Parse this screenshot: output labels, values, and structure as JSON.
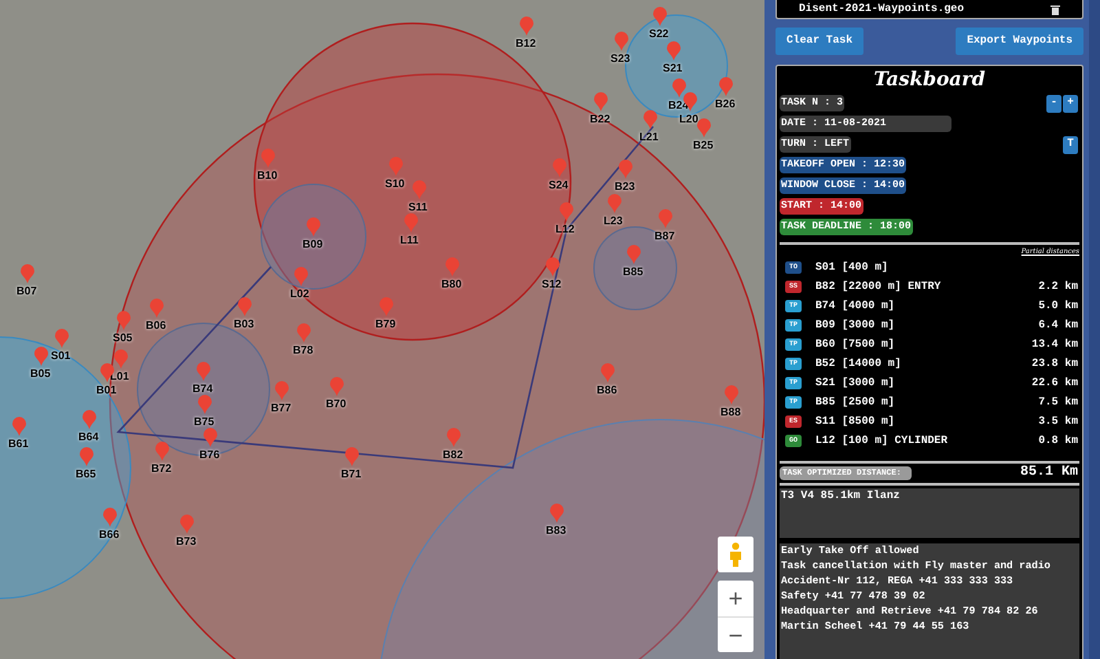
{
  "map": {
    "waypoints": [
      {
        "label": "B12"
      },
      {
        "label": "S22"
      },
      {
        "label": "S23"
      },
      {
        "label": "S21"
      },
      {
        "label": "B24"
      },
      {
        "label": "L20"
      },
      {
        "label": "B26"
      },
      {
        "label": "B22"
      },
      {
        "label": "L21"
      },
      {
        "label": "B25"
      },
      {
        "label": "B10"
      },
      {
        "label": "S10"
      },
      {
        "label": "S11"
      },
      {
        "label": "L11"
      },
      {
        "label": "B09"
      },
      {
        "label": "L02"
      },
      {
        "label": "S24"
      },
      {
        "label": "B23"
      },
      {
        "label": "L23"
      },
      {
        "label": "L12"
      },
      {
        "label": "B87"
      },
      {
        "label": "B80"
      },
      {
        "label": "S12"
      },
      {
        "label": "B85"
      },
      {
        "label": "B79"
      },
      {
        "label": "B07"
      },
      {
        "label": "B06"
      },
      {
        "label": "B03"
      },
      {
        "label": "S05"
      },
      {
        "label": "S01"
      },
      {
        "label": "B05"
      },
      {
        "label": "L01"
      },
      {
        "label": "B01"
      },
      {
        "label": "B78"
      },
      {
        "label": "B74"
      },
      {
        "label": "B75"
      },
      {
        "label": "B77"
      },
      {
        "label": "B70"
      },
      {
        "label": "B61"
      },
      {
        "label": "B64"
      },
      {
        "label": "B65"
      },
      {
        "label": "B72"
      },
      {
        "label": "B76"
      },
      {
        "label": "B71"
      },
      {
        "label": "B66"
      },
      {
        "label": "B73"
      },
      {
        "label": "B86"
      },
      {
        "label": "B88"
      },
      {
        "label": "B82"
      },
      {
        "label": "B83"
      }
    ],
    "zoom_in": "+",
    "zoom_out": "−"
  },
  "file": {
    "name": "Disent-2021-Waypoints.geo"
  },
  "buttons": [
    {
      "label": "Clear Task"
    },
    {
      "label": "Export Waypoints"
    }
  ],
  "taskboard": {
    "title": "Taskboard",
    "fields": [
      {
        "text": "TASK N : 3",
        "kind": "neutral",
        "controls": [
          "-",
          "+"
        ]
      },
      {
        "text": "DATE : 11-08-2021",
        "kind": "neutral",
        "wide": true
      },
      {
        "text": "TURN : LEFT",
        "kind": "neutral",
        "controls": [
          "T"
        ]
      },
      {
        "text": "TAKEOFF OPEN : 12:30",
        "kind": "info"
      },
      {
        "text": "WINDOW CLOSE : 14:00",
        "kind": "info"
      },
      {
        "text": "START : 14:00",
        "kind": "danger"
      },
      {
        "text": "TASK DEADLINE : 18:00",
        "kind": "success"
      }
    ],
    "partial_header": "Partial distances",
    "turnpoints": [
      {
        "type": "TO",
        "kind": "info",
        "name": "S01 [400 m]"
      },
      {
        "type": "SS",
        "kind": "danger",
        "name": "B82 [22000 m] ENTRY",
        "distance": "2.2 km"
      },
      {
        "type": "TP",
        "kind": "turn",
        "name": "B74 [4000 m]",
        "distance": "5.0 km"
      },
      {
        "type": "TP",
        "kind": "turn",
        "name": "B09 [3000 m]",
        "distance": "6.4 km"
      },
      {
        "type": "TP",
        "kind": "turn",
        "name": "B60 [7500 m]",
        "distance": "13.4 km"
      },
      {
        "type": "TP",
        "kind": "turn",
        "name": "B52 [14000 m]",
        "distance": "23.8 km"
      },
      {
        "type": "TP",
        "kind": "turn",
        "name": "S21 [3000 m]",
        "distance": "22.6 km"
      },
      {
        "type": "TP",
        "kind": "turn",
        "name": "B85 [2500 m]",
        "distance": "7.5 km"
      },
      {
        "type": "ES",
        "kind": "danger",
        "name": "S11 [8500 m]",
        "distance": "3.5 km"
      },
      {
        "type": "GO",
        "kind": "success",
        "name": "L12 [100 m] CYLINDER",
        "distance": "0.8 km"
      }
    ],
    "optimized_label": "TASK OPTIMIZED DISTANCE:",
    "optimized_value": "85.1 Km",
    "task_name": "T3 V4 85.1km Ilanz",
    "notes": [
      "Early Take Off allowed",
      "Task cancellation with Fly master and radio",
      "Accident-Nr 112, REGA +41 333 333 333",
      "Safety +41 77 478 39 02",
      "Headquarter and Retrieve +41 79 784 82 26",
      "Martin Scheel +41 79 44 55 163"
    ]
  }
}
